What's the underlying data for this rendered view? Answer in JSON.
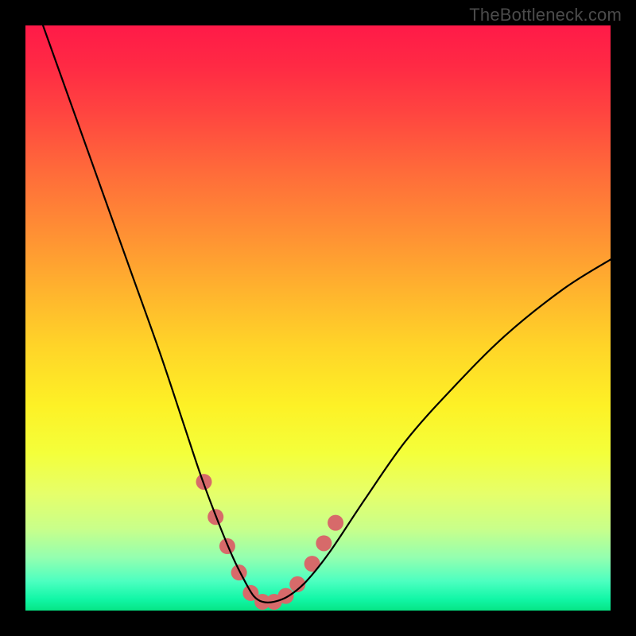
{
  "watermark": "TheBottleneck.com",
  "chart_data": {
    "type": "line",
    "title": "",
    "xlabel": "",
    "ylabel": "",
    "xlim": [
      0,
      100
    ],
    "ylim": [
      0,
      100
    ],
    "grid": false,
    "legend": false,
    "series": [
      {
        "name": "bottleneck-curve",
        "color": "#000000",
        "x": [
          3,
          8,
          13,
          18,
          23,
          27,
          30,
          33,
          35.5,
          37.5,
          39,
          40.5,
          42.5,
          45,
          48,
          52,
          58,
          65,
          73,
          82,
          92,
          100
        ],
        "y": [
          100,
          86,
          72,
          58,
          44,
          32,
          23,
          15,
          9,
          5,
          2.5,
          1.5,
          1.5,
          2.5,
          5,
          10,
          19,
          29,
          38,
          47,
          55,
          60
        ]
      }
    ],
    "markers": [
      {
        "name": "highlight-dots",
        "color": "#d76a6a",
        "radius_px": 10,
        "points": [
          {
            "x": 30.5,
            "y": 22
          },
          {
            "x": 32.5,
            "y": 16
          },
          {
            "x": 34.5,
            "y": 11
          },
          {
            "x": 36.5,
            "y": 6.5
          },
          {
            "x": 38.5,
            "y": 3
          },
          {
            "x": 40.5,
            "y": 1.5
          },
          {
            "x": 42.5,
            "y": 1.5
          },
          {
            "x": 44.5,
            "y": 2.5
          },
          {
            "x": 46.5,
            "y": 4.5
          },
          {
            "x": 49,
            "y": 8
          },
          {
            "x": 51,
            "y": 11.5
          },
          {
            "x": 53,
            "y": 15
          }
        ]
      }
    ]
  }
}
